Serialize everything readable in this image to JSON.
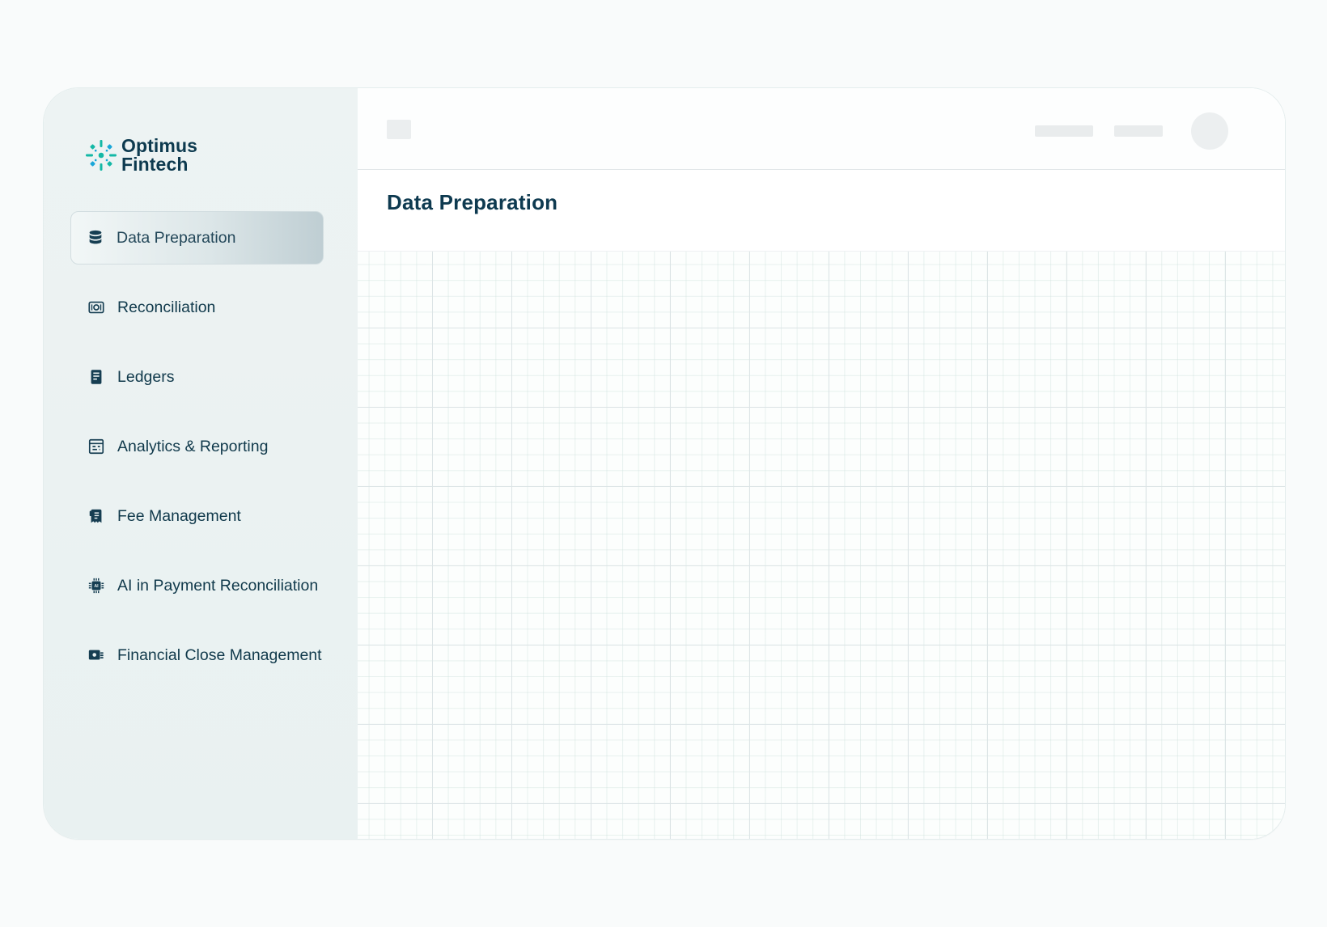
{
  "brand": {
    "line1": "Optimus",
    "line2": "Fintech",
    "colors": {
      "primary": "#0d3a4f",
      "accent_teal": "#13b8a6",
      "accent_cyan": "#1aa7d8"
    }
  },
  "sidebar": {
    "items": [
      {
        "label": "Data Preparation",
        "icon": "database-icon",
        "active": true
      },
      {
        "label": "Reconciliation",
        "icon": "reconciliation-icon",
        "active": false
      },
      {
        "label": "Ledgers",
        "icon": "ledger-icon",
        "active": false
      },
      {
        "label": "Analytics & Reporting",
        "icon": "analytics-icon",
        "active": false
      },
      {
        "label": "Fee Management",
        "icon": "fee-icon",
        "active": false
      },
      {
        "label": "AI in Payment Reconciliation",
        "icon": "ai-chip-icon",
        "active": false
      },
      {
        "label": "Financial Close Management",
        "icon": "financial-close-icon",
        "active": false
      }
    ]
  },
  "main": {
    "title": "Data Preparation"
  }
}
